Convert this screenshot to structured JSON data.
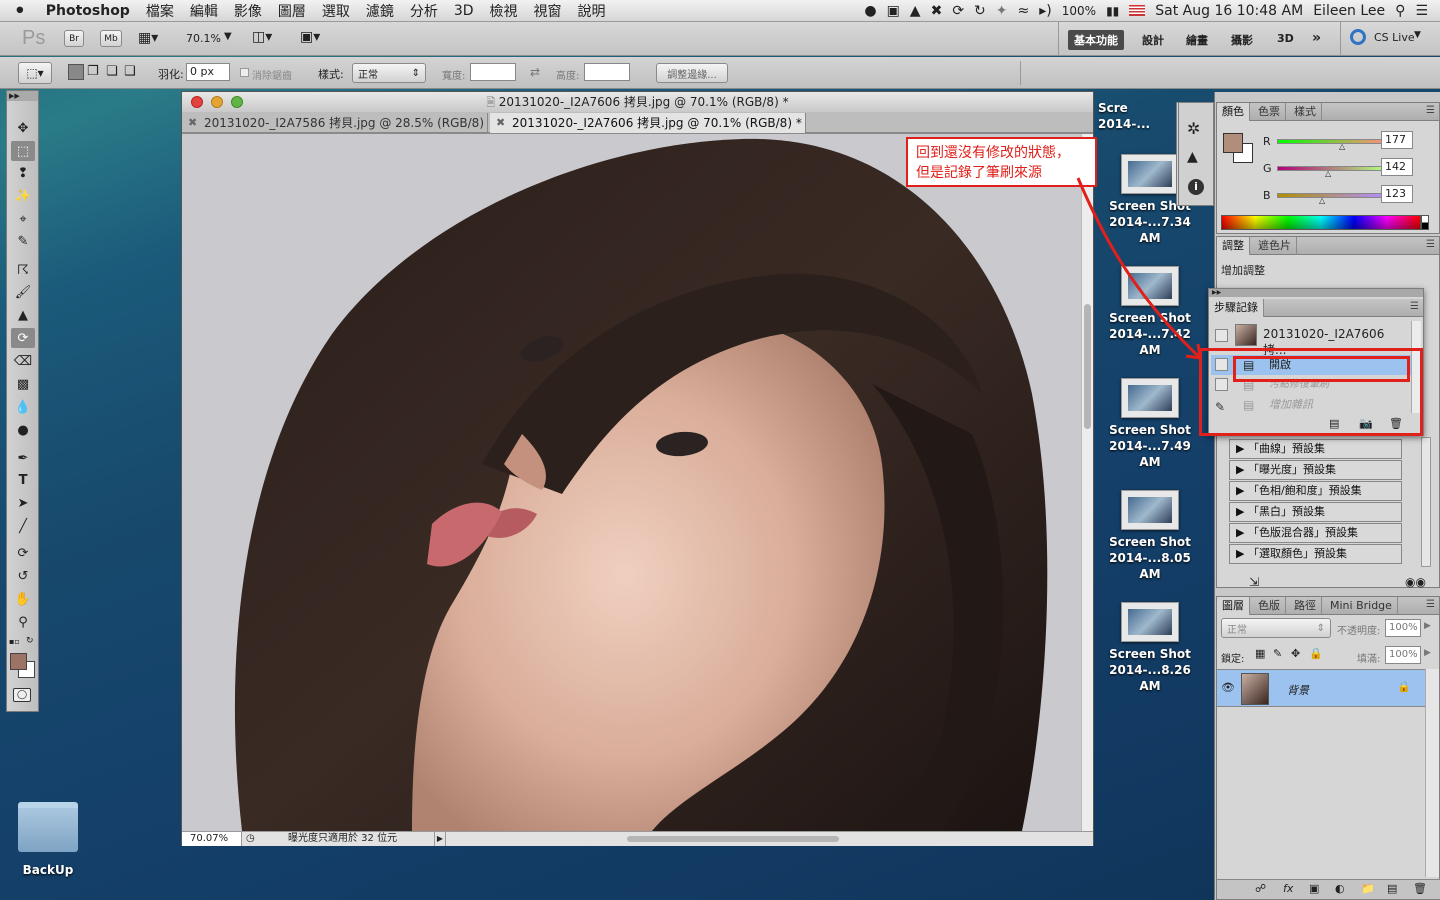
{
  "menubar": {
    "apple": "",
    "app": "Photoshop",
    "items": [
      "檔案",
      "編輯",
      "影像",
      "圖層",
      "選取",
      "濾鏡",
      "分析",
      "3D",
      "檢視",
      "視窗",
      "說明"
    ],
    "battery": "100%",
    "datetime": "Sat Aug 16  10:48 AM",
    "user": "Eileen Lee"
  },
  "appbar": {
    "logo": "Ps",
    "br": "Br",
    "mb": "Mb",
    "zoom": "70.1%",
    "workspaces": [
      "基本功能",
      "設計",
      "繪畫",
      "攝影",
      "3D"
    ],
    "more": "»",
    "cs_live": "CS Live"
  },
  "options": {
    "feather_label": "羽化:",
    "feather_value": "0 px",
    "antialias": "消除鋸齒",
    "style_label": "樣式:",
    "style_value": "正常",
    "width_label": "寬度:",
    "height_label": "高度:",
    "refine_edge": "調整邊緣..."
  },
  "document": {
    "title": "20131020-_I2A7606 拷貝.jpg @ 70.1% (RGB/8) *",
    "tabs": [
      "20131020-_I2A7586 拷貝.jpg @ 28.5% (RGB/8)",
      "20131020-_I2A7606 拷貝.jpg @ 70.1% (RGB/8) *"
    ],
    "zoom": "70.07%",
    "status": "曝光度只適用於 32 位元"
  },
  "desktop": {
    "screenshots": [
      {
        "name": "Screen Shot",
        "time": "2014-...7.34 AM"
      },
      {
        "name": "Screen Shot",
        "time": "2014-...7.42 AM"
      },
      {
        "name": "Screen Shot",
        "time": "2014-...7.49 AM"
      },
      {
        "name": "Screen Shot",
        "time": "2014-...8.05 AM"
      },
      {
        "name": "Screen Shot",
        "time": "2014-...8.26 AM"
      }
    ],
    "top_partial": {
      "name": "Scre",
      "time": "2014-..."
    },
    "folder": "BackUp"
  },
  "color_panel": {
    "tabs": [
      "顏色",
      "色票",
      "樣式"
    ],
    "r_label": "R",
    "g_label": "G",
    "b_label": "B",
    "r": "177",
    "g": "142",
    "b": "123",
    "foreground": "#b18e7b"
  },
  "adjust_panel": {
    "tabs": [
      "調整",
      "遮色片"
    ],
    "title": "增加調整"
  },
  "history_panel": {
    "tab": "步驟記錄",
    "snapshot": "20131020-_I2A7606 拷...",
    "steps": [
      "開啟",
      "污點修復筆刷",
      "增加雜訊"
    ]
  },
  "presets": [
    "「曲線」預設集",
    "「曝光度」預設集",
    "「色相/飽和度」預設集",
    "「黑白」預設集",
    "「色版混合器」預設集",
    "「選取顏色」預設集"
  ],
  "layers_panel": {
    "tabs": [
      "圖層",
      "色版",
      "路徑",
      "Mini Bridge"
    ],
    "blend": "正常",
    "opacity_label": "不透明度:",
    "opacity": "100%",
    "lock_label": "鎖定:",
    "fill_label": "填滿:",
    "fill": "100%",
    "layer_name": "背景"
  },
  "annotation": {
    "line1": "回到還沒有修改的狀態，",
    "line2": "但是記錄了筆刷來源"
  }
}
